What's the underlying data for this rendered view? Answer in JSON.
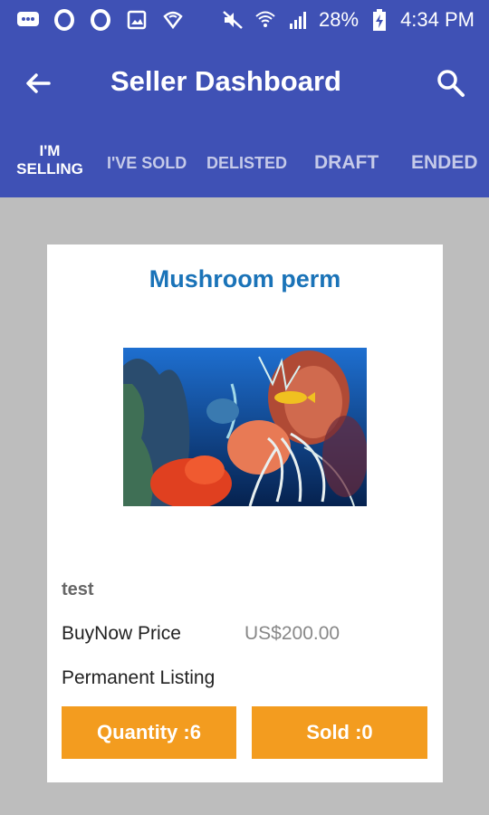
{
  "status_bar": {
    "battery": "28%",
    "time": "4:34 PM"
  },
  "header": {
    "title": "Seller Dashboard"
  },
  "tabs": [
    {
      "label": "I'M SELLING",
      "active": true
    },
    {
      "label": "I'VE SOLD",
      "active": false
    },
    {
      "label": "DELISTED",
      "active": false
    },
    {
      "label": "DRAFT",
      "active": false
    },
    {
      "label": "ENDED",
      "active": false
    }
  ],
  "listing": {
    "title": "Mushroom perm",
    "description": "test",
    "price_label": "BuyNow Price",
    "price_value": "US$200.00",
    "listing_type": "Permanent Listing",
    "quantity_button": "Quantity :6",
    "sold_button": "Sold :0"
  },
  "colors": {
    "primary": "#3f51b5",
    "accent": "#f39c1f",
    "title_blue": "#1a73b8",
    "background": "#bdbdbd"
  }
}
